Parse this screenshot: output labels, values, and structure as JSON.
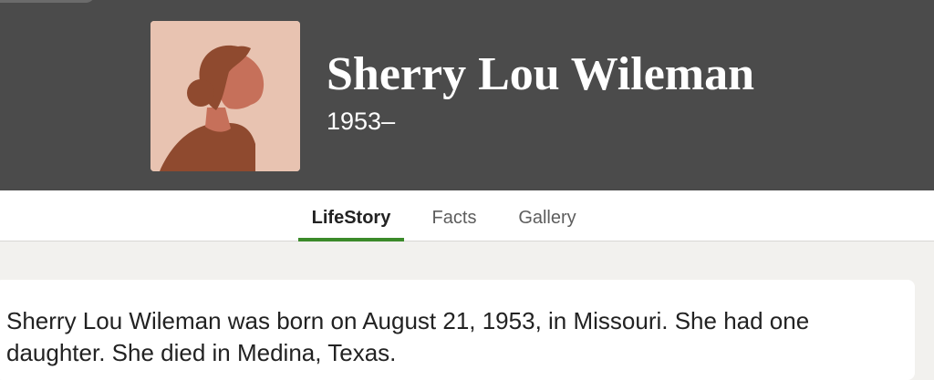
{
  "header": {
    "name": "Sherry Lou Wileman",
    "dates": "1953–"
  },
  "avatar": {
    "icon": "woman-silhouette-icon",
    "colors": {
      "background": "#e8c3b1",
      "hair": "#8f4a2f",
      "skin": "#c6705a",
      "top": "#8f4a2f"
    }
  },
  "tabs": [
    {
      "label": "LifeStory",
      "active": true
    },
    {
      "label": "Facts",
      "active": false
    },
    {
      "label": "Gallery",
      "active": false
    }
  ],
  "story": {
    "text": "Sherry Lou Wileman was born on August 21, 1953, in Missouri. She had one daughter. She died in Medina, Texas."
  },
  "colors": {
    "header_bg": "#4b4b4b",
    "page_bg": "#f2f1ee",
    "active_tab_underline": "#3b8a2a"
  }
}
